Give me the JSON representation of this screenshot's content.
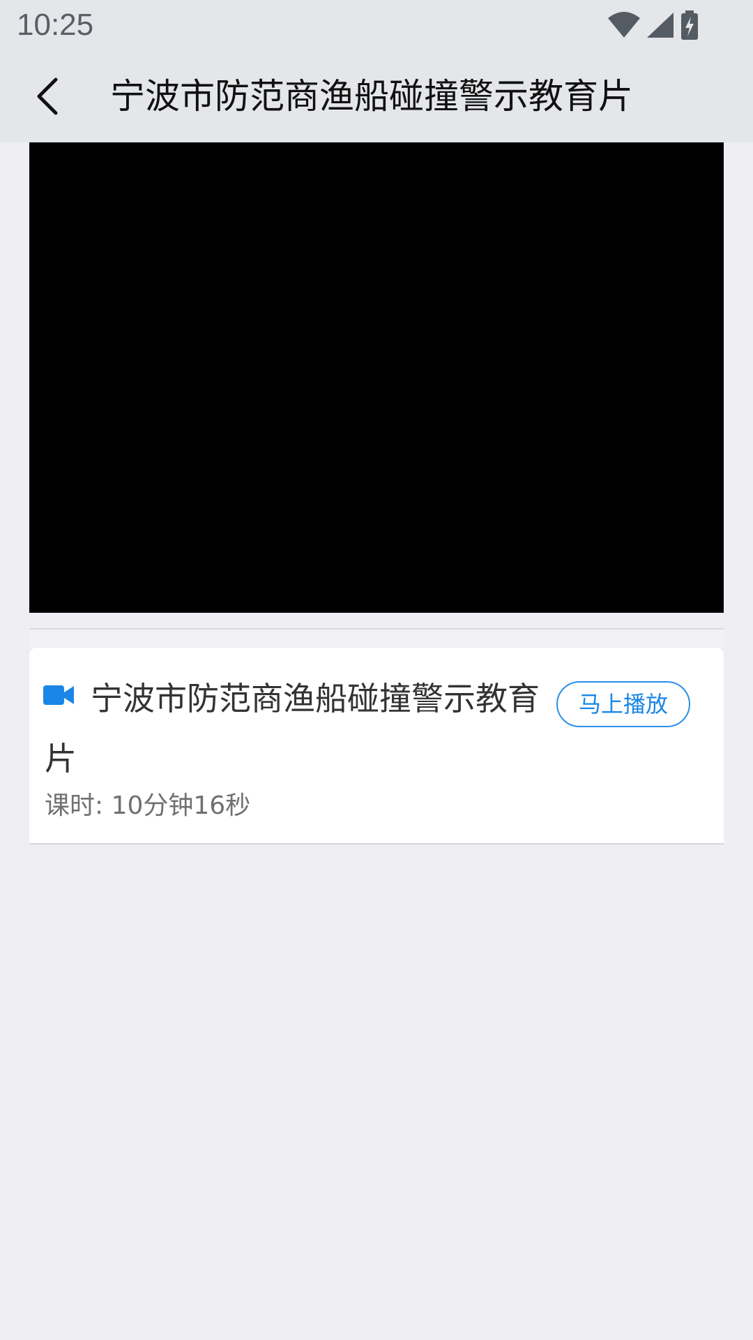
{
  "status_bar": {
    "time": "10:25",
    "icons": [
      "wifi-icon",
      "cell-signal-icon",
      "battery-charging-icon"
    ]
  },
  "header": {
    "title": "宁波市防范商渔船碰撞警示教育片",
    "back_icon": "chevron-left-icon"
  },
  "course": {
    "title": "宁波市防范商渔船碰撞警示教育片",
    "play_button_label": "马上播放",
    "duration": "课时: 10分钟16秒",
    "icon": "video-camera-icon"
  },
  "colors": {
    "accent": "#1a86e6",
    "appbar_bg": "#e4e6e9",
    "page_bg": "#eeeef3",
    "video_bg": "#000000"
  }
}
